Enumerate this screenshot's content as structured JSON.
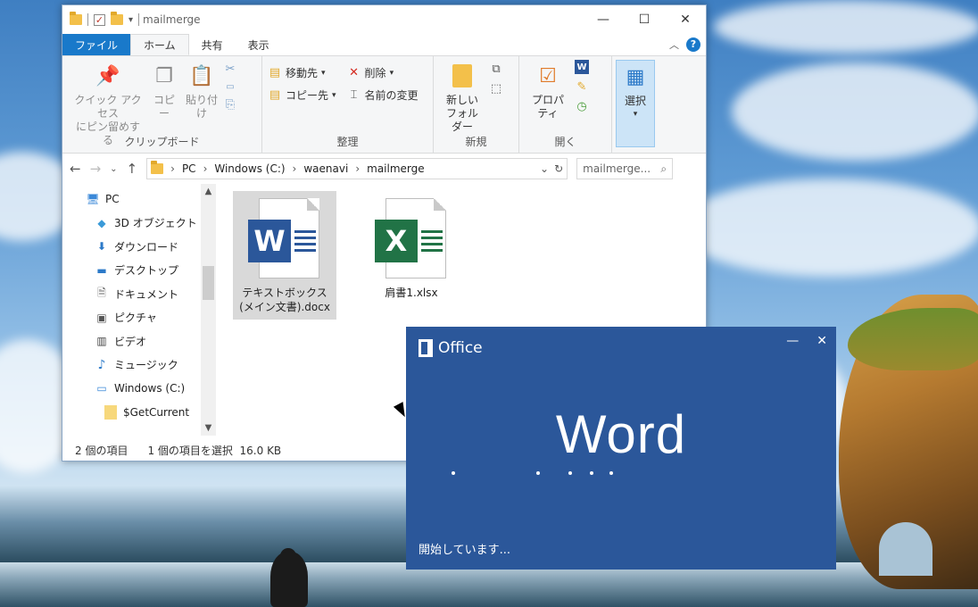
{
  "explorer": {
    "title": "mailmerge",
    "tabs": [
      "ファイル",
      "ホーム",
      "共有",
      "表示"
    ],
    "ribbon": {
      "clipboard": {
        "label": "クリップボード",
        "pin": "クイック アクセス\nにピン留めする",
        "copy": "コピー",
        "paste": "貼り付け"
      },
      "organize": {
        "label": "整理",
        "move": "移動先",
        "copyto": "コピー先",
        "delete": "削除",
        "rename": "名前の変更"
      },
      "new": {
        "label": "新規",
        "newfolder": "新しい\nフォルダー"
      },
      "open": {
        "label": "開く",
        "properties": "プロパティ"
      },
      "select": {
        "label": "選択"
      }
    },
    "address": {
      "crumbs": [
        "PC",
        "Windows (C:)",
        "waenavi",
        "mailmerge"
      ],
      "search_placeholder": "mailmerge..."
    },
    "nav": [
      {
        "label": "PC",
        "icon": "pc-icon"
      },
      {
        "label": "3D オブジェクト",
        "icon": "3d-objects-icon"
      },
      {
        "label": "ダウンロード",
        "icon": "download-icon"
      },
      {
        "label": "デスクトップ",
        "icon": "desktop-icon"
      },
      {
        "label": "ドキュメント",
        "icon": "documents-icon"
      },
      {
        "label": "ピクチャ",
        "icon": "pictures-icon"
      },
      {
        "label": "ビデオ",
        "icon": "videos-icon"
      },
      {
        "label": "ミュージック",
        "icon": "music-icon"
      },
      {
        "label": "Windows (C:)",
        "icon": "drive-icon"
      },
      {
        "label": "$GetCurrent",
        "icon": "folder-icon"
      }
    ],
    "files": [
      {
        "name": "テキストボックス(メイン文書).docx",
        "type": "word",
        "selected": true
      },
      {
        "name": "肩書1.xlsx",
        "type": "excel",
        "selected": false
      }
    ],
    "status": {
      "count": "2 個の項目",
      "selection": "1 個の項目を選択  16.0 KB"
    }
  },
  "splash": {
    "brand": "Office",
    "app": "Word",
    "status": "開始しています...",
    "color": "#2b579a"
  }
}
